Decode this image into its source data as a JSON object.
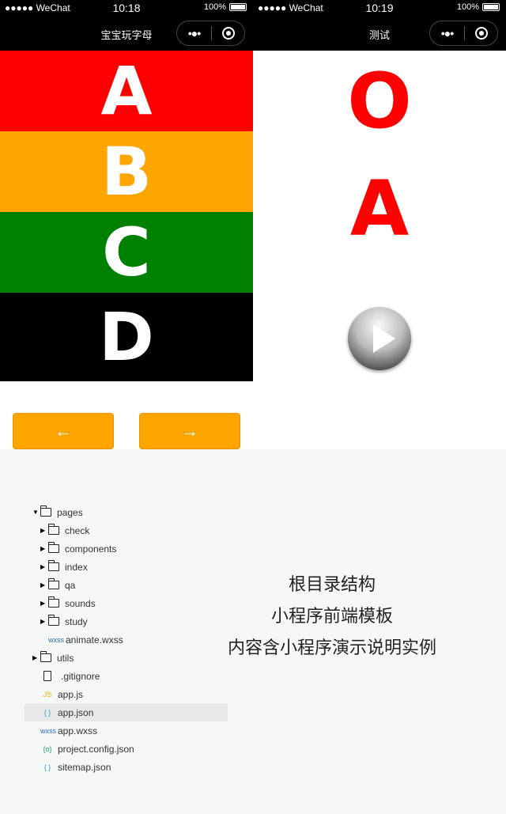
{
  "left_phone": {
    "status": {
      "carrier": "●●●●● WeChat",
      "time": "10:18",
      "battery": "100%"
    },
    "title": "宝宝玩字母",
    "letters": [
      {
        "text": "A",
        "color": "#ff0000"
      },
      {
        "text": "B",
        "color": "#ffa500"
      },
      {
        "text": "C",
        "color": "#008000"
      },
      {
        "text": "D",
        "color": "#000000"
      }
    ],
    "prev_label": "←",
    "next_label": "→"
  },
  "right_phone": {
    "status": {
      "carrier": "●●●●● WeChat",
      "time": "10:19",
      "battery": "100%"
    },
    "title": "测试",
    "letter1": "O",
    "letter2": "A",
    "play_icon": "play-button-icon"
  },
  "capsule": {
    "more": "•●•"
  },
  "tree": [
    {
      "label": "pages",
      "type": "folder-open",
      "depth": 0,
      "arrow": "▼"
    },
    {
      "label": "check",
      "type": "folder",
      "depth": 1,
      "arrow": "▶"
    },
    {
      "label": "components",
      "type": "folder",
      "depth": 1,
      "arrow": "▶"
    },
    {
      "label": "index",
      "type": "folder",
      "depth": 1,
      "arrow": "▶"
    },
    {
      "label": "qa",
      "type": "folder",
      "depth": 1,
      "arrow": "▶"
    },
    {
      "label": "sounds",
      "type": "folder",
      "depth": 1,
      "arrow": "▶"
    },
    {
      "label": "study",
      "type": "folder",
      "depth": 1,
      "arrow": "▶"
    },
    {
      "label": "animate.wxss",
      "type": "wxss",
      "depth": 1,
      "icon": "wxss"
    },
    {
      "label": "utils",
      "type": "folder",
      "depth": 0,
      "arrow": "▶"
    },
    {
      "label": ".gitignore",
      "type": "file",
      "depth": 0
    },
    {
      "label": "app.js",
      "type": "js",
      "depth": 0,
      "icon": "JS"
    },
    {
      "label": "app.json",
      "type": "json",
      "depth": 0,
      "icon": "{ }",
      "selected": true
    },
    {
      "label": "app.wxss",
      "type": "wxss",
      "depth": 0,
      "icon": "wxss"
    },
    {
      "label": "project.config.json",
      "type": "config",
      "depth": 0,
      "icon": "{o}"
    },
    {
      "label": "sitemap.json",
      "type": "json",
      "depth": 0,
      "icon": "{ }"
    }
  ],
  "description": [
    "根目录结构",
    "小程序前端模板",
    "内容含小程序演示说明实例"
  ]
}
